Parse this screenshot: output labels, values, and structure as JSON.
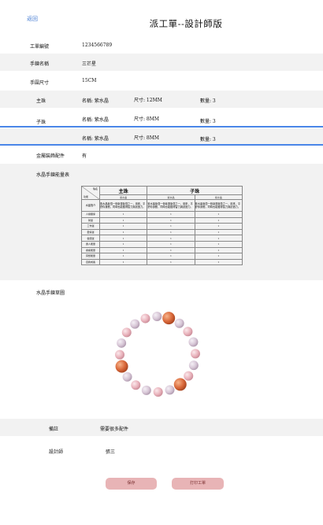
{
  "back_label": "返回",
  "page_title": "派工單--設計師版",
  "fields": [
    {
      "label": "工單編號",
      "value": "1234566789"
    },
    {
      "label": "手鍊名稱",
      "value": "三芒星"
    },
    {
      "label": "手圍尺寸",
      "value": "15CM"
    }
  ],
  "beads": [
    {
      "label": "主珠",
      "name": "名稱: 紫水晶",
      "size": "尺寸: 12MM",
      "qty": "數量: 3"
    },
    {
      "label": "子珠",
      "name": "名稱: 紫水晶",
      "size": "尺寸: 8MM",
      "qty": "數量: 3"
    },
    {
      "label": "",
      "name": "名稱: 紫水晶",
      "size": "尺寸: 8MM",
      "qty": "數量: 3"
    }
  ],
  "metal_label": "金屬裝飾配件",
  "metal_value": "有",
  "table_section_label": "水晶手鍊能量表",
  "table": {
    "corner_top": "珠名",
    "corner_bottom": "功能",
    "main_header": "主珠",
    "sub_header": "子珠",
    "stone_names": [
      "紫水晶",
      "紫水晶",
      "紫水晶"
    ],
    "desc_label": "水晶簡介",
    "descriptions": [
      "紫水晶象徵一個幸運象徵之一，用來，平舒你身體，同時也能獲得智力與創造力。",
      "紫水晶象徵一個幸運象徵之一，用來，平舒你身體，同時也能獲得智力與創造力。",
      "紫水晶象徵一個幸運象徵之一，用來，平舒你身體，同時也能獲得智力與創造力。"
    ],
    "rows": [
      {
        "label": "人緣關係",
        "values": [
          "1",
          "1",
          "1"
        ]
      },
      {
        "label": "財運",
        "values": [
          "1",
          "1",
          "1"
        ]
      },
      {
        "label": "工作運",
        "values": [
          "1",
          "1",
          "1"
        ]
      },
      {
        "label": "愛情運",
        "values": [
          "1",
          "1",
          "1"
        ]
      },
      {
        "label": "健康運",
        "values": [
          "1",
          "1",
          "1"
        ]
      },
      {
        "label": "貴人能量",
        "values": [
          "1",
          "1",
          "1"
        ]
      },
      {
        "label": "療癒能量",
        "values": [
          "1",
          "1",
          "1"
        ]
      },
      {
        "label": "冥想能量",
        "values": [
          "1",
          "1",
          "1"
        ]
      },
      {
        "label": "自我成長",
        "values": [
          "1",
          "1",
          "1"
        ]
      }
    ]
  },
  "sketch_label": "水晶手鍊草圖",
  "note_label": "備註",
  "note_value": "需要很多配件",
  "designer_label": "設計師",
  "designer_value": "張三",
  "buttons": {
    "save": "保存",
    "print": "打印工單"
  },
  "colors": {
    "accent_blue": "#4a86e8",
    "button_pink": "#e8b4b6",
    "grey_row": "#f2f2f2"
  }
}
